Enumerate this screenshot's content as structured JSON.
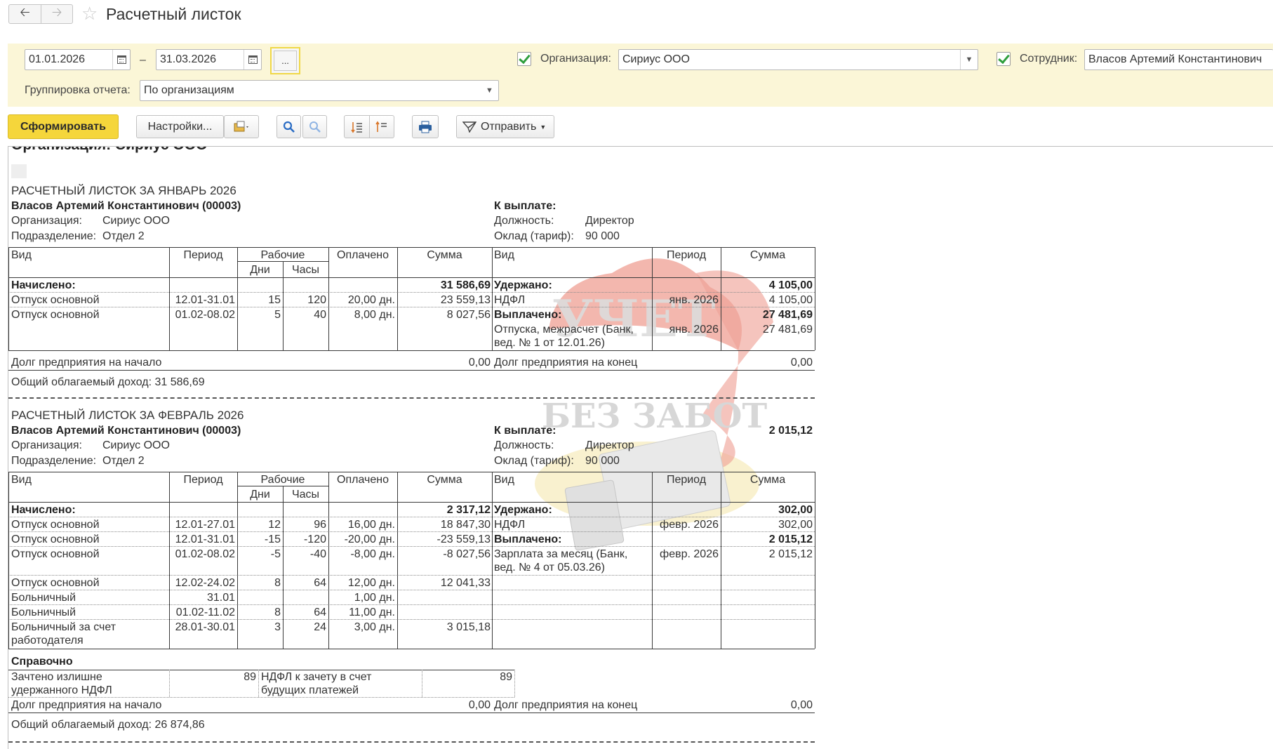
{
  "window": {
    "title": "Расчетный листок",
    "nav_back_icon": "arrow-left-icon",
    "nav_forward_icon": "arrow-right-icon",
    "favorite_icon": "star-icon"
  },
  "params": {
    "date_from": "01.01.2026",
    "date_to": "31.03.2026",
    "date_separator": "–",
    "period_button": "...",
    "org_label": "Организация:",
    "org_value": "Сириус ООО",
    "org_checked": true,
    "employee_label": "Сотрудник:",
    "employee_value": "Власов Артемий Константинович",
    "employee_checked": true,
    "grouping_label": "Группировка отчета:",
    "grouping_value": "По организациям"
  },
  "toolbar": {
    "generate": "Сформировать",
    "settings": "Настройки...",
    "send": "Отправить"
  },
  "colors": {
    "primary_button": "#f5d63b",
    "panel_background": "#fbf6d7",
    "checkbox_check": "#2e9e3c"
  },
  "report": {
    "org_heading": "Организация: Сириус ООО",
    "headers": {
      "kind": "Вид",
      "period": "Период",
      "working": "Рабочие",
      "days": "Дни",
      "hours": "Часы",
      "paid": "Оплачено",
      "sum": "Сумма"
    },
    "sheets": [
      {
        "title": "РАСЧЕТНЫЙ ЛИСТОК ЗА ЯНВАРЬ 2026",
        "employee": "Власов Артемий Константинович (00003)",
        "org_label": "Организация:",
        "org_value": "Сириус ООО",
        "dept_label": "Подразделение:",
        "dept_value": "Отдел 2",
        "to_pay_label": "К выплате:",
        "to_pay_value": "",
        "position_label": "Должность:",
        "position_value": "Директор",
        "salary_label": "Оклад (тариф):",
        "salary_value": "90 000",
        "accrued_label": "Начислено:",
        "accrued_total": "31 586,69",
        "accruals": [
          {
            "kind": "Отпуск основной",
            "period": "12.01-31.01",
            "days": "15",
            "hours": "120",
            "paid": "20,00 дн.",
            "sum": "23 559,13"
          },
          {
            "kind": "Отпуск основной",
            "period": "01.02-08.02",
            "days": "5",
            "hours": "40",
            "paid": "8,00 дн.",
            "sum": "8 027,56"
          }
        ],
        "withheld_label": "Удержано:",
        "withheld_total": "4 105,00",
        "ndfl": {
          "kind": "НДФЛ",
          "period": "янв. 2026",
          "sum": "4 105,00"
        },
        "paid_out_label": "Выплачено:",
        "paid_out_total": "27 481,69",
        "payment": {
          "kind_line1": "Отпуска, межрасчет (Банк,",
          "kind_line2": "вед. № 1 от 12.01.26)",
          "period": "янв. 2026",
          "sum": "27 481,69"
        },
        "debt_start_label": "Долг предприятия на начало",
        "debt_start": "0,00",
        "debt_end_label": "Долг предприятия на конец",
        "debt_end": "0,00",
        "taxable_income": "Общий облагаемый доход: 31 586,69"
      },
      {
        "title": "РАСЧЕТНЫЙ ЛИСТОК ЗА ФЕВРАЛЬ 2026",
        "employee": "Власов Артемий Константинович (00003)",
        "org_label": "Организация:",
        "org_value": "Сириус ООО",
        "dept_label": "Подразделение:",
        "dept_value": "Отдел 2",
        "to_pay_label": "К выплате:",
        "to_pay_value": "2 015,12",
        "position_label": "Должность:",
        "position_value": "Директор",
        "salary_label": "Оклад (тариф):",
        "salary_value": "90 000",
        "accrued_label": "Начислено:",
        "accrued_total": "2 317,12",
        "accruals": [
          {
            "kind": "Отпуск основной",
            "period": "12.01-27.01",
            "days": "12",
            "hours": "96",
            "paid": "16,00 дн.",
            "sum": "18 847,30"
          },
          {
            "kind": "Отпуск основной",
            "period": "12.01-31.01",
            "days": "-15",
            "hours": "-120",
            "paid": "-20,00 дн.",
            "sum": "-23 559,13"
          },
          {
            "kind": "Отпуск основной",
            "period": "01.02-08.02",
            "days": "-5",
            "hours": "-40",
            "paid": "-8,00 дн.",
            "sum": "-8 027,56"
          },
          {
            "kind": "Отпуск основной",
            "period": "12.02-24.02",
            "days": "8",
            "hours": "64",
            "paid": "12,00 дн.",
            "sum": "12 041,33"
          },
          {
            "kind": "Больничный",
            "period": "31.01",
            "days": "",
            "hours": "",
            "paid": "1,00 дн.",
            "sum": ""
          },
          {
            "kind": "Больничный",
            "period": "01.02-11.02",
            "days": "8",
            "hours": "64",
            "paid": "11,00 дн.",
            "sum": ""
          },
          {
            "kind": "Больничный за счет",
            "kind_line2": "работодателя",
            "period": "28.01-30.01",
            "days": "3",
            "hours": "24",
            "paid": "3,00 дн.",
            "sum": "3 015,18"
          }
        ],
        "withheld_label": "Удержано:",
        "withheld_total": "302,00",
        "ndfl": {
          "kind": "НДФЛ",
          "period": "февр. 2026",
          "sum": "302,00"
        },
        "paid_out_label": "Выплачено:",
        "paid_out_total": "2 015,12",
        "payment": {
          "kind_line1": "Зарплата за месяц (Банк,",
          "kind_line2": "вед. № 4 от 05.03.26)",
          "period": "февр. 2026",
          "sum": "2 015,12"
        },
        "reference_label": "Справочно",
        "reference": {
          "item1_line1": "Зачтено излишне",
          "item1_line2": "удержанного НДФЛ",
          "item1_value": "89",
          "item2_line1": "НДФЛ к зачету в счет",
          "item2_line2": "будущих платежей",
          "item2_value": "89"
        },
        "debt_start_label": "Долг предприятия на начало",
        "debt_start": "0,00",
        "debt_end_label": "Долг предприятия на конец",
        "debt_end": "0,00",
        "taxable_income": "Общий облагаемый доход: 26 874,86"
      }
    ]
  }
}
